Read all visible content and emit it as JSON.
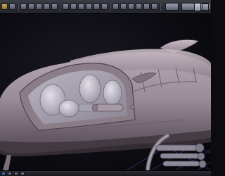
{
  "toolbar": {
    "tools": [
      {
        "icon": "move-tool-icon",
        "active": true
      },
      {
        "icon": "rotate-tool-icon",
        "active": false
      },
      {
        "icon": "scale-tool-icon",
        "active": false
      },
      {
        "icon": "select-tool-icon",
        "active": false
      },
      {
        "icon": "brush-tool-icon",
        "active": false
      },
      {
        "icon": "smooth-tool-icon",
        "active": false
      },
      {
        "icon": "grab-tool-icon",
        "active": false
      },
      {
        "icon": "pinch-tool-icon",
        "active": false
      },
      {
        "icon": "flatten-tool-icon",
        "active": false
      },
      {
        "icon": "knife-tool-icon",
        "active": false
      },
      {
        "icon": "mask-tool-icon",
        "active": false
      },
      {
        "icon": "stamp-tool-icon",
        "active": false
      },
      {
        "icon": "wire-tool-icon",
        "active": false
      },
      {
        "icon": "light-tool-icon",
        "active": false
      },
      {
        "icon": "camera-tool-icon",
        "active": false
      },
      {
        "icon": "render-tool-icon",
        "active": false
      },
      {
        "icon": "material-tool-icon",
        "active": false
      },
      {
        "icon": "texture-tool-icon",
        "active": false
      },
      {
        "icon": "layers-tool-icon",
        "active": false
      }
    ]
  },
  "viewport": {
    "subject": "3d-vehicle-model",
    "colors": {
      "body": "#9a8d97",
      "body_shadow": "#5b4f58",
      "glass": "#b7b2c1",
      "seat": "#cfcbd6",
      "grid": "#3a3a7a"
    }
  },
  "statusbar": {
    "buttons": [
      {
        "icon": "view-front-icon",
        "active": true
      },
      {
        "icon": "view-side-icon",
        "active": false
      },
      {
        "icon": "view-top-icon",
        "active": false
      },
      {
        "icon": "view-perspective-icon",
        "active": false
      }
    ]
  }
}
